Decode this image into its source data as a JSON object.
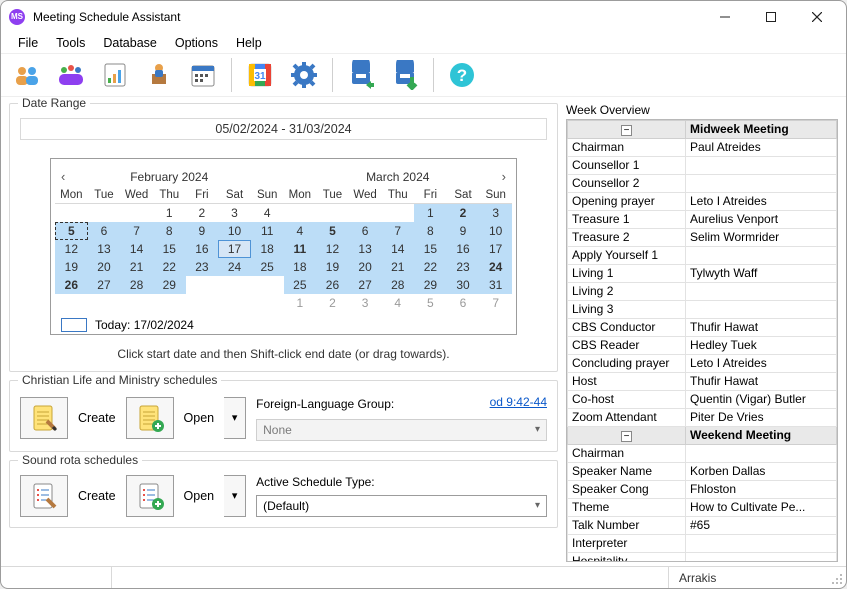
{
  "title": "Meeting Schedule Assistant",
  "menu": {
    "file": "File",
    "tools": "Tools",
    "database": "Database",
    "options": "Options",
    "help": "Help"
  },
  "toolbar_icons": [
    "people",
    "group",
    "report",
    "speaker",
    "calendar",
    "gcal",
    "settings",
    "export-down",
    "export-up",
    "help"
  ],
  "date_range": {
    "legend": "Date Range",
    "display": "05/02/2024 - 31/03/2024",
    "today_label": "Today: 17/02/2024",
    "hint": "Click start date and then Shift-click end date (or drag towards).",
    "left": {
      "title": "February 2024",
      "days": [
        "Mon",
        "Tue",
        "Wed",
        "Thu",
        "Fri",
        "Sat",
        "Sun"
      ],
      "rows": [
        [
          {
            "n": "",
            "cls": ""
          },
          {
            "n": "",
            "cls": ""
          },
          {
            "n": "",
            "cls": ""
          },
          {
            "n": "1",
            "cls": ""
          },
          {
            "n": "2",
            "cls": ""
          },
          {
            "n": "3",
            "cls": ""
          },
          {
            "n": "4",
            "cls": ""
          }
        ],
        [
          {
            "n": "5",
            "cls": "range today-start",
            "bold": true
          },
          {
            "n": "6",
            "cls": "range"
          },
          {
            "n": "7",
            "cls": "range"
          },
          {
            "n": "8",
            "cls": "range"
          },
          {
            "n": "9",
            "cls": "range"
          },
          {
            "n": "10",
            "cls": "range"
          },
          {
            "n": "11",
            "cls": "range"
          }
        ],
        [
          {
            "n": "12",
            "cls": "range"
          },
          {
            "n": "13",
            "cls": "range"
          },
          {
            "n": "14",
            "cls": "range"
          },
          {
            "n": "15",
            "cls": "range"
          },
          {
            "n": "16",
            "cls": "range"
          },
          {
            "n": "17",
            "cls": "range sel"
          },
          {
            "n": "18",
            "cls": "range"
          }
        ],
        [
          {
            "n": "19",
            "cls": "range"
          },
          {
            "n": "20",
            "cls": "range"
          },
          {
            "n": "21",
            "cls": "range"
          },
          {
            "n": "22",
            "cls": "range"
          },
          {
            "n": "23",
            "cls": "range"
          },
          {
            "n": "24",
            "cls": "range"
          },
          {
            "n": "25",
            "cls": "range"
          }
        ],
        [
          {
            "n": "26",
            "cls": "range",
            "bold": true
          },
          {
            "n": "27",
            "cls": "range"
          },
          {
            "n": "28",
            "cls": "range"
          },
          {
            "n": "29",
            "cls": "range"
          },
          {
            "n": "",
            "cls": ""
          },
          {
            "n": "",
            "cls": ""
          },
          {
            "n": "",
            "cls": ""
          }
        ],
        [
          {
            "n": "",
            "cls": ""
          },
          {
            "n": "",
            "cls": ""
          },
          {
            "n": "",
            "cls": ""
          },
          {
            "n": "",
            "cls": ""
          },
          {
            "n": "",
            "cls": ""
          },
          {
            "n": "",
            "cls": ""
          },
          {
            "n": "",
            "cls": ""
          }
        ]
      ]
    },
    "right": {
      "title": "March 2024",
      "days": [
        "Mon",
        "Tue",
        "Wed",
        "Thu",
        "Fri",
        "Sat",
        "Sun"
      ],
      "rows": [
        [
          {
            "n": "",
            "cls": ""
          },
          {
            "n": "",
            "cls": ""
          },
          {
            "n": "",
            "cls": ""
          },
          {
            "n": "",
            "cls": ""
          },
          {
            "n": "1",
            "cls": "range"
          },
          {
            "n": "2",
            "cls": "range",
            "bold": true
          },
          {
            "n": "3",
            "cls": "range"
          }
        ],
        [
          {
            "n": "4",
            "cls": "range"
          },
          {
            "n": "5",
            "cls": "range",
            "bold": true
          },
          {
            "n": "6",
            "cls": "range"
          },
          {
            "n": "7",
            "cls": "range"
          },
          {
            "n": "8",
            "cls": "range"
          },
          {
            "n": "9",
            "cls": "range"
          },
          {
            "n": "10",
            "cls": "range"
          }
        ],
        [
          {
            "n": "11",
            "cls": "range",
            "bold": true
          },
          {
            "n": "12",
            "cls": "range"
          },
          {
            "n": "13",
            "cls": "range"
          },
          {
            "n": "14",
            "cls": "range"
          },
          {
            "n": "15",
            "cls": "range"
          },
          {
            "n": "16",
            "cls": "range"
          },
          {
            "n": "17",
            "cls": "range"
          }
        ],
        [
          {
            "n": "18",
            "cls": "range"
          },
          {
            "n": "19",
            "cls": "range"
          },
          {
            "n": "20",
            "cls": "range"
          },
          {
            "n": "21",
            "cls": "range"
          },
          {
            "n": "22",
            "cls": "range"
          },
          {
            "n": "23",
            "cls": "range"
          },
          {
            "n": "24",
            "cls": "range",
            "bold": true
          }
        ],
        [
          {
            "n": "25",
            "cls": "range"
          },
          {
            "n": "26",
            "cls": "range"
          },
          {
            "n": "27",
            "cls": "range"
          },
          {
            "n": "28",
            "cls": "range"
          },
          {
            "n": "29",
            "cls": "range"
          },
          {
            "n": "30",
            "cls": "range"
          },
          {
            "n": "31",
            "cls": "range"
          }
        ],
        [
          {
            "n": "1",
            "cls": "other"
          },
          {
            "n": "2",
            "cls": "other"
          },
          {
            "n": "3",
            "cls": "other"
          },
          {
            "n": "4",
            "cls": "other"
          },
          {
            "n": "5",
            "cls": "other"
          },
          {
            "n": "6",
            "cls": "other"
          },
          {
            "n": "7",
            "cls": "other"
          }
        ]
      ]
    }
  },
  "clm": {
    "legend": "Christian Life and Ministry schedules",
    "create": "Create",
    "open": "Open",
    "group_label": "Foreign-Language Group:",
    "group_value": "None",
    "link": "od 9:42-44"
  },
  "srs": {
    "legend": "Sound rota schedules",
    "create": "Create",
    "open": "Open",
    "type_label": "Active Schedule Type:",
    "type_value": "(Default)"
  },
  "overview": {
    "title": "Week Overview",
    "groups": [
      {
        "name": "Midweek Meeting",
        "rows": [
          {
            "k": "Chairman",
            "v": "Paul Atreides"
          },
          {
            "k": "Counsellor 1",
            "v": ""
          },
          {
            "k": "Counsellor 2",
            "v": ""
          },
          {
            "k": "Opening prayer",
            "v": "Leto I Atreides"
          },
          {
            "k": "Treasure 1",
            "v": "Aurelius Venport"
          },
          {
            "k": "Treasure 2",
            "v": "Selim Wormrider"
          },
          {
            "k": "Apply Yourself 1",
            "v": ""
          },
          {
            "k": "Living 1",
            "v": "Tylwyth Waff"
          },
          {
            "k": "Living 2",
            "v": ""
          },
          {
            "k": "Living 3",
            "v": ""
          },
          {
            "k": "CBS Conductor",
            "v": "Thufir Hawat"
          },
          {
            "k": "CBS Reader",
            "v": "Hedley Tuek"
          },
          {
            "k": "Concluding prayer",
            "v": "Leto I Atreides"
          },
          {
            "k": "Host",
            "v": "Thufir Hawat"
          },
          {
            "k": "Co-host",
            "v": "Quentin (Vigar) Butler"
          },
          {
            "k": "Zoom Attendant",
            "v": "Piter De Vries"
          }
        ]
      },
      {
        "name": "Weekend Meeting",
        "rows": [
          {
            "k": "Chairman",
            "v": ""
          },
          {
            "k": "Speaker Name",
            "v": "Korben Dallas"
          },
          {
            "k": "Speaker Cong",
            "v": "Fhloston"
          },
          {
            "k": "Theme",
            "v": "How to Cultivate Pe..."
          },
          {
            "k": "Talk Number",
            "v": "#65"
          },
          {
            "k": "Interpreter",
            "v": ""
          },
          {
            "k": "Hospitality",
            "v": ""
          }
        ]
      }
    ]
  },
  "status": {
    "right": "Arrakis"
  }
}
